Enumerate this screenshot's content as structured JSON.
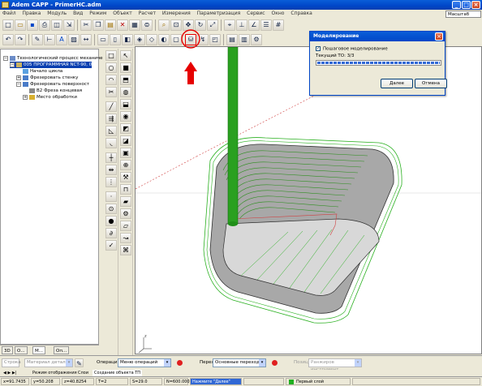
{
  "window": {
    "title": "Adem CAPP - PrimerHC.adm"
  },
  "menu": [
    "Файл",
    "Правка",
    "Модуль",
    "Вид",
    "Режим",
    "Объект",
    "Расчет",
    "Измерения",
    "Параметризация",
    "Сервис",
    "Окно",
    "Справка"
  ],
  "scale_label": "Масштаб +1:1",
  "tree": {
    "items": [
      {
        "label": "Технологический процесс механиче"
      },
      {
        "label": "005 ПРОГРАММНАЯ NCT-90, 0"
      },
      {
        "label": "Начало цикла"
      },
      {
        "label": "Фрезеровать стенку"
      },
      {
        "label": "Фрезеровать поверхност"
      },
      {
        "label": "В2 Фреза концевая"
      },
      {
        "label": "Место обработки"
      }
    ],
    "tabs": [
      "3D",
      "О...",
      "М...",
      "Оп..."
    ]
  },
  "dialog": {
    "title": "Моделирование",
    "checkbox_label": "Пошаговое моделирование",
    "current_label": "Текущий ТО: 3/3",
    "progress": 1.0,
    "next_button": "Далее",
    "cancel_button": "Отмена"
  },
  "bottom": {
    "operations_label": "Операции",
    "operations_value": "Меню операций",
    "transitions_label": "Переходы",
    "transitions_value": "Основные переходы",
    "disabled_combo": "Позиция",
    "disabled_combo_value": "Ранжиров инструмент",
    "left_combo": "Строка",
    "left_combo_value": "Материал детали"
  },
  "tabs_row": [
    "Режим отображения",
    "Слои",
    "Создание объекта ТП"
  ],
  "status": {
    "x": "x=91.7435",
    "y": "y=50.208",
    "z": "z=40.8254",
    "t": "T=2",
    "s": "S=29.0",
    "n": "N=600.0000",
    "hint": "Нажмите \"Далее\"",
    "layer": "Первый слой"
  },
  "colors": {
    "title_blue": "#0046c8",
    "tool_green": "#2aa020",
    "wire_green": "#18a018",
    "arrow_red": "#e60000",
    "progress_blue": "#3168d5"
  }
}
